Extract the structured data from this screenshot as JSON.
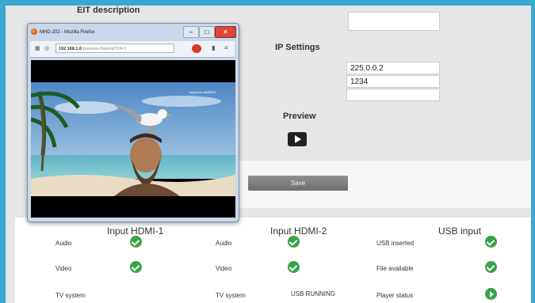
{
  "page": {
    "eit_heading": "EIT description",
    "ip_heading": "IP Settings",
    "ip_address": "225.0.0.2",
    "port": "1234",
    "preview_heading": "Preview",
    "save_label": "Save"
  },
  "status": {
    "columns": [
      {
        "title": "Input HDMI-1",
        "rows": [
          {
            "label": "Audio",
            "ok": true
          },
          {
            "label": "Video",
            "ok": true
          },
          {
            "label": "TV system",
            "ok": false
          }
        ]
      },
      {
        "title": "Input HDMI-2",
        "rows": [
          {
            "label": "Audio",
            "ok": true
          },
          {
            "label": "Video",
            "ok": true
          },
          {
            "label": "TV system",
            "value": "USB RUNNING"
          }
        ]
      },
      {
        "title": "USB input",
        "rows": [
          {
            "label": "USB inserted",
            "ok": true
          },
          {
            "label": "File available",
            "ok": true
          },
          {
            "label": "Player status",
            "play": true
          }
        ]
      }
    ]
  },
  "popup": {
    "title": "MHD-202 - Mozilla Firefox",
    "url_host": "192.168.1.6",
    "url_path": "/preview-channel?ch=1",
    "watermark": "www.tvtv.net/BEST"
  },
  "colors": {
    "frame": "#38a8cf",
    "ok_green": "#3aa248",
    "save_button": "#7a7c7e"
  }
}
